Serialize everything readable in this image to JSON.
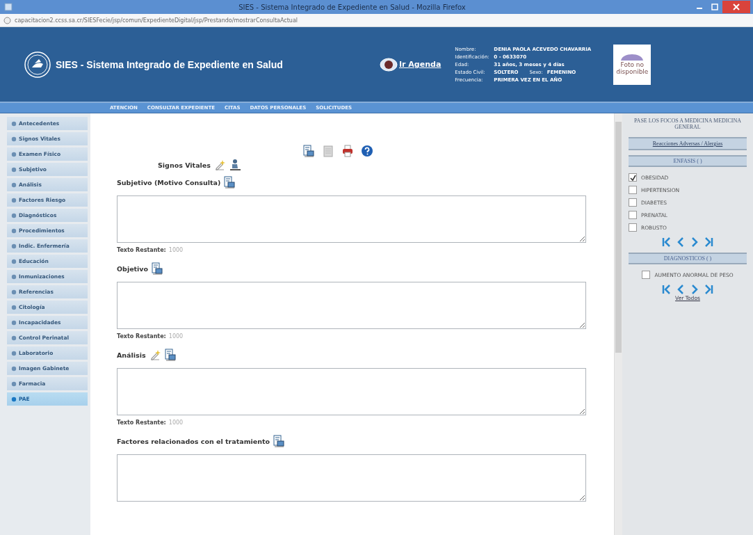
{
  "browser": {
    "title": "SIES - Sistema Integrado de Expediente en Salud - Mozilla Firefox",
    "url": "capacitacion2.ccss.sa.cr/SIESFecie/jsp/comun/ExpedienteDigital/jsp/Prestando/mostrarConsultaActual"
  },
  "header": {
    "app_title": "SIES - Sistema Integrado de Expediente en Salud",
    "agenda_link": "Ir Agenda",
    "patient_rows": [
      [
        {
          "label": "Nombre:",
          "value": "DENIA PAOLA ACEVEDO CHAVARRIA"
        }
      ],
      [
        {
          "label": "Identificación:",
          "value": "0 - 0633070"
        }
      ],
      [
        {
          "label": "Edad:",
          "value": "31 años, 3 meses y 4 días"
        }
      ],
      [
        {
          "label": "Estado Civil:",
          "value": "SOLTERO"
        },
        {
          "label": "Sexo:",
          "value": "FEMENINO"
        }
      ],
      [
        {
          "label": "Frecuencia:",
          "value": "PRIMERA VEZ EN EL AÑO"
        }
      ]
    ],
    "photo": "Foto no disponible"
  },
  "nav": [
    "ATENCION",
    "CONSULTAR EXPEDIENTE",
    "CITAS",
    "DATOS PERSONALES",
    "SOLICITUDES"
  ],
  "sidebar": {
    "items": [
      {
        "label": "Antecedentes",
        "selected": false
      },
      {
        "label": "Signos Vitales",
        "selected": false
      },
      {
        "label": "Examen Físico",
        "selected": false
      },
      {
        "label": "Subjetivo",
        "selected": false
      },
      {
        "label": "Análisis",
        "selected": false
      },
      {
        "label": "Factores Riesgo",
        "selected": false
      },
      {
        "label": "Diagnósticos",
        "selected": false
      },
      {
        "label": "Procedimientos",
        "selected": false
      },
      {
        "label": "Indic. Enfermería",
        "selected": false
      },
      {
        "label": "Educación",
        "selected": false
      },
      {
        "label": "Inmunizaciones",
        "selected": false
      },
      {
        "label": "Referencias",
        "selected": false
      },
      {
        "label": "Citología",
        "selected": false
      },
      {
        "label": "Incapacidades",
        "selected": false
      },
      {
        "label": "Control Perinatal",
        "selected": false
      },
      {
        "label": "Laboratorio",
        "selected": false
      },
      {
        "label": "Imagen Gabinete",
        "selected": false
      },
      {
        "label": "Farmacia",
        "selected": false
      },
      {
        "label": "PAE",
        "selected": true
      }
    ]
  },
  "vitals": {
    "label": "Signos Vitales"
  },
  "sections": [
    {
      "title": "Subjetivo (Motivo Consulta)",
      "has_edit": false,
      "remaining_label": "Texto Restante:",
      "remaining": "1000"
    },
    {
      "title": "Objetivo",
      "has_edit": false,
      "remaining_label": "Texto Restante:",
      "remaining": "1000"
    },
    {
      "title": "Análisis",
      "has_edit": true,
      "remaining_label": "Texto Restante:",
      "remaining": "1000"
    },
    {
      "title": "Factores relacionados con el tratamiento",
      "has_edit": false
    }
  ],
  "right_panel": {
    "heading": "PASE LOS FOCOS A MEDICINA MEDICINA GENERAL",
    "allergy_link": "Reacciones Adversas / Alergias",
    "emphasis": {
      "title": "ENFASIS ( )",
      "items": [
        {
          "label": "OBESIDAD",
          "checked": true
        },
        {
          "label": "HIPERTENSION",
          "checked": false
        },
        {
          "label": "DIABETES",
          "checked": false
        },
        {
          "label": "PRENATAL",
          "checked": false
        },
        {
          "label": "ROBUSTO",
          "checked": false
        }
      ]
    },
    "diagnoses": {
      "title": "DIAGNOSTICOS ( )",
      "items": [
        {
          "label": "AUMENTO ANORMAL DE PESO",
          "checked": false
        }
      ]
    },
    "see_all": "Ver Todos"
  }
}
